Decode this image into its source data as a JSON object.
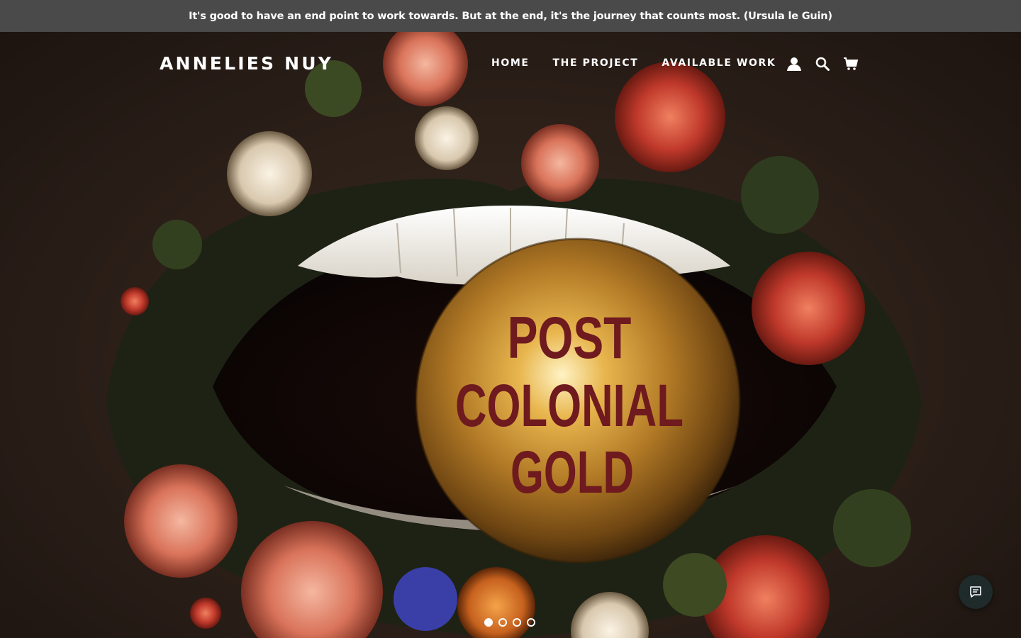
{
  "announcement": {
    "text": "It's good to have an end point to work towards. But at the end, it's the journey that counts most. (Ursula le Guin)"
  },
  "header": {
    "logo": "ANNELIES NUY",
    "nav": [
      {
        "label": "HOME"
      },
      {
        "label": "THE PROJECT"
      },
      {
        "label": "AVAILABLE WORK"
      }
    ],
    "icons": [
      "account-icon",
      "search-icon",
      "cart-icon"
    ]
  },
  "hero": {
    "slide_text": [
      "POST",
      "COLONIAL",
      "GOLD"
    ],
    "slides_total": 4,
    "active_slide": 1
  },
  "colors": {
    "announcement_bg": "#4a4a4a",
    "text_white": "#ffffff",
    "gold": "#b8862e",
    "title_red": "#6e1a1e"
  },
  "chat": {
    "icon": "chat-icon"
  }
}
